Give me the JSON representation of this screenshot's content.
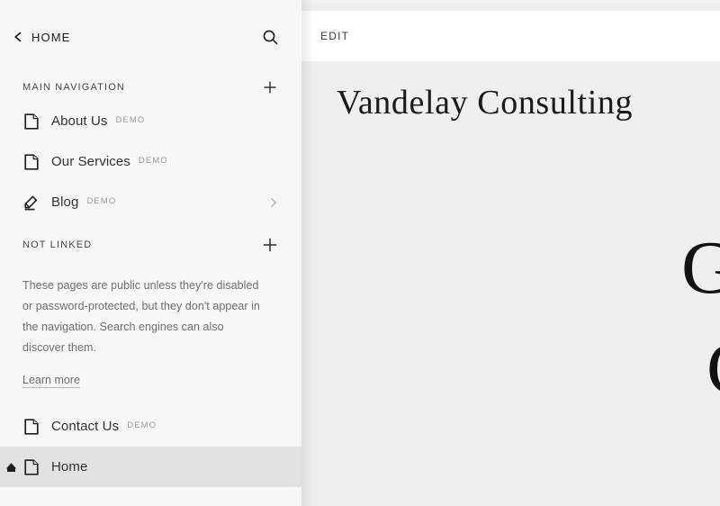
{
  "sidebar": {
    "back": {
      "label": "HOME",
      "icon": "chevron-left-icon"
    },
    "search": {
      "icon": "search-icon"
    },
    "sections": [
      {
        "id": "main-navigation",
        "title": "MAIN NAVIGATION",
        "add_icon": "plus-icon",
        "items": [
          {
            "label": "About Us",
            "badge": "DEMO",
            "icon": "page-icon",
            "selected": false,
            "chevron": false,
            "home": false
          },
          {
            "label": "Our Services",
            "badge": "DEMO",
            "icon": "page-icon",
            "selected": false,
            "chevron": false,
            "home": false
          },
          {
            "label": "Blog",
            "badge": "DEMO",
            "icon": "blog-pen-icon",
            "selected": false,
            "chevron": true,
            "home": false
          }
        ]
      },
      {
        "id": "not-linked",
        "title": "NOT LINKED",
        "add_icon": "plus-icon",
        "note": "These pages are public unless they're disabled or password-protected, but they don't appear in the navigation. Search engines can also discover them.",
        "learn_more": "Learn more",
        "items": [
          {
            "label": "Contact Us",
            "badge": "DEMO",
            "icon": "page-icon",
            "selected": false,
            "chevron": false,
            "home": false
          },
          {
            "label": "Home",
            "badge": "",
            "icon": "page-icon",
            "selected": true,
            "chevron": false,
            "home": true
          }
        ]
      }
    ]
  },
  "preview": {
    "toolbar": {
      "edit_label": "EDIT"
    },
    "site_title": "Vandelay Consulting",
    "hero_lines": [
      "G",
      "C"
    ]
  },
  "colors": {
    "sidebar_bg": "#f7f7f6",
    "selected_row": "#e2e2e1",
    "preview_bg": "#efefed",
    "toolbar_bg": "#ffffff",
    "text_primary": "#2f3437",
    "text_muted": "#6f6f6f",
    "badge": "#9b9b9b"
  }
}
